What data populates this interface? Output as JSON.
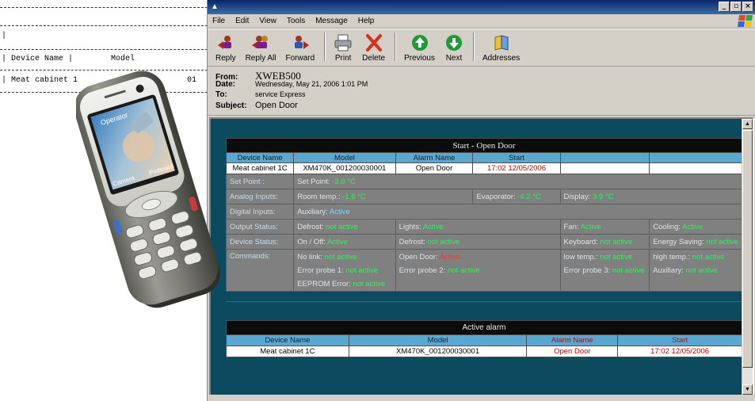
{
  "terminal": {
    "pipe": "|",
    "header_row": "| Device Name |        Model",
    "data_row": "| Meat cabinet 1",
    "data_row_end": "01"
  },
  "window": {
    "buttons": [
      "_",
      "▫",
      "×"
    ]
  },
  "menu": [
    "File",
    "Edit",
    "View",
    "Tools",
    "Message",
    "Help"
  ],
  "toolbar": {
    "reply": "Reply",
    "reply_all": "Reply All",
    "forward": "Forward",
    "print": "Print",
    "delete": "Delete",
    "previous": "Previous",
    "next": "Next",
    "addresses": "Addresses"
  },
  "header": {
    "from_label": "From:",
    "from": "XWEB500",
    "date_label": "Date:",
    "date": "Wednesday, May 21, 2006 1:01 PM",
    "to_label": "To:",
    "to": "service Express",
    "subject_label": "Subject:",
    "subject": "Open Door"
  },
  "alarm": {
    "title": "Start - Open Door",
    "columns": [
      "Device Name",
      "Model",
      "Alarm Name",
      "Start",
      "",
      ""
    ],
    "row": [
      "Meat cabinet 1C",
      "XM470K_001200030001",
      "Open Door",
      "17:02 12/05/2006",
      "",
      ""
    ],
    "set_point": {
      "label": "Set Point :",
      "name": "Set Point:",
      "value": "-3.0 °C"
    },
    "analog": {
      "label": "Analog Inputs:",
      "items": [
        {
          "name": "Room temp.:",
          "value": "-1.6 °C"
        },
        {
          "name": "Evaporator:",
          "value": "-4.2 °C"
        },
        {
          "name": "Display:",
          "value": "3.9 °C"
        }
      ]
    },
    "digital": {
      "label": "Digital Inputs:",
      "name": "Auxiliary:",
      "value": "Active"
    },
    "output": {
      "label": "Output Status:",
      "items": [
        {
          "name": "Defrost:",
          "value": "not active"
        },
        {
          "name": "Lights:",
          "value": "Active"
        },
        {
          "name": "Fan:",
          "value": "Active"
        },
        {
          "name": "Cooling:",
          "value": "Active"
        }
      ]
    },
    "device": {
      "label": "Device Status:",
      "items": [
        {
          "name": "On / Off:",
          "value": "Active"
        },
        {
          "name": "Defrost:",
          "value": "not active"
        },
        {
          "name": "Keyboard:",
          "value": "not active"
        },
        {
          "name": "Energy Saving:",
          "value": "not active"
        }
      ]
    },
    "commands": {
      "label": "Commands:",
      "row1": [
        {
          "name": "No link:",
          "value": "not active"
        },
        {
          "name": "Open Door:",
          "value": "Active"
        },
        {
          "name": "low temp.:",
          "value": "not active"
        },
        {
          "name": "high temp.:",
          "value": "not active"
        }
      ],
      "row2": [
        {
          "name": "Error probe 1:",
          "value": "not active"
        },
        {
          "name": "Error probe 2:",
          "value": "not active"
        },
        {
          "name": "Error probe 3:",
          "value": "not active"
        },
        {
          "name": "Auxiliary:",
          "value": "not active"
        }
      ],
      "row3": [
        {
          "name": "EEPROM Error:",
          "value": "not active"
        }
      ]
    }
  },
  "active_alarm": {
    "title": "Active alarm",
    "columns": [
      "Device Name",
      "Model",
      "Alarm Name",
      "Start"
    ],
    "row": [
      "Meat cabinet 1C",
      "XM470K_001200030001",
      "Open Door",
      "17:02 12/05/2006"
    ]
  },
  "phone": {
    "screen_title": "Operator",
    "softkey_left": "Camera",
    "softkey_right": "Pinboard"
  },
  "colors": {
    "body_bg": "#0b4a5f",
    "header_cells": "#5aa7d2",
    "status_green": "#2cf25a",
    "alarm_red": "#c00000"
  }
}
